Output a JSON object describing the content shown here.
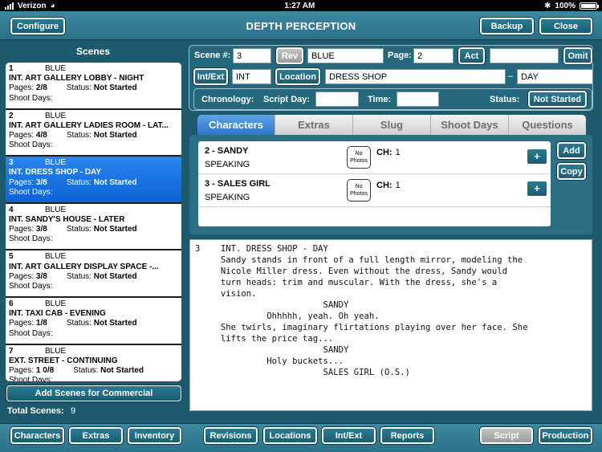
{
  "status_bar": {
    "carrier": "Verizon",
    "time": "1:27 AM",
    "battery": "100%"
  },
  "header": {
    "title": "DEPTH PERCEPTION",
    "configure": "Configure",
    "backup": "Backup",
    "close": "Close"
  },
  "scenes_panel": {
    "title": "Scenes",
    "pages_label": "Pages:",
    "status_label": "Status:",
    "shoot_days_label": "Shoot Days:",
    "items": [
      {
        "num": "1",
        "color": "BLUE",
        "heading": "INT. ART GALLERY LOBBY - NIGHT",
        "pages": "2/8",
        "status": "Not Started"
      },
      {
        "num": "2",
        "color": "BLUE",
        "heading": "INT. ART GALLERY LADIES ROOM - LAT...",
        "pages": "4/8",
        "status": "Not Started"
      },
      {
        "num": "3",
        "color": "BLUE",
        "heading": "INT. DRESS SHOP - DAY",
        "pages": "3/8",
        "status": "Not Started"
      },
      {
        "num": "4",
        "color": "BLUE",
        "heading": "INT. SANDY'S HOUSE - LATER",
        "pages": "3/8",
        "status": "Not Started"
      },
      {
        "num": "5",
        "color": "BLUE",
        "heading": "INT. ART GALLERY DISPLAY SPACE -...",
        "pages": "3/8",
        "status": "Not Started"
      },
      {
        "num": "6",
        "color": "BLUE",
        "heading": "INT. TAXI CAB - EVENING",
        "pages": "1/8",
        "status": "Not Started"
      },
      {
        "num": "7",
        "color": "BLUE",
        "heading": "EXT. STREET - CONTINUING",
        "pages": "1 0/8",
        "status": "Not Started"
      }
    ],
    "add_commercial": "Add Scenes for Commercial",
    "total_label": "Total Scenes:",
    "total_value": "9"
  },
  "scene_form": {
    "scene_num_label": "Scene #:",
    "scene_num": "3",
    "rev": "Rev",
    "color": "BLUE",
    "page_label": "Page:",
    "page": "2",
    "act": "Act",
    "act_value": "",
    "omit": "Omit",
    "intext_btn": "Int/Ext",
    "intext_value": "INT",
    "location_btn": "Location",
    "location_value": "DRESS SHOP",
    "dash": "–",
    "time_of_day": "DAY",
    "chronology_label": "Chronology:",
    "script_day_label": "Script Day:",
    "script_day": "",
    "time_label": "Time:",
    "time": "",
    "status_label": "Status:",
    "status_btn": "Not Started"
  },
  "tabs": [
    "Characters",
    "Extras",
    "Slug",
    "Shoot Days",
    "Questions"
  ],
  "characters": [
    {
      "name": "2 - SANDY",
      "role": "SPEAKING",
      "photo": "No Photos",
      "ch_label": "CH:",
      "ch": "1"
    },
    {
      "name": "3 - SALES GIRL",
      "role": "SPEAKING",
      "photo": "No Photos",
      "ch_label": "CH:",
      "ch": "1"
    }
  ],
  "char_actions": {
    "add": "Add",
    "copy": "Copy",
    "plus": "+"
  },
  "script_lines": [
    "3    INT. DRESS SHOP - DAY",
    "",
    "     Sandy stands in front of a full length mirror, modeling the",
    "     Nicole Miller dress. Even without the dress, Sandy would",
    "     turn heads: trim and muscular. With the dress, she's a",
    "     vision.",
    "                         SANDY",
    "              Ohhhhh, yeah. Oh yeah.",
    "",
    "     She twirls, imaginary flirtations playing over her face. She",
    "     lifts the price tag...",
    "",
    "                         SANDY",
    "              Holy buckets...",
    "",
    "                         SALES GIRL (O.S.)"
  ],
  "bottom_nav": {
    "characters": "Characters",
    "extras": "Extras",
    "inventory": "Inventory",
    "revisions": "Revisions",
    "locations": "Locations",
    "intext": "Int/Ext",
    "reports": "Reports",
    "script": "Script",
    "production": "Production"
  }
}
